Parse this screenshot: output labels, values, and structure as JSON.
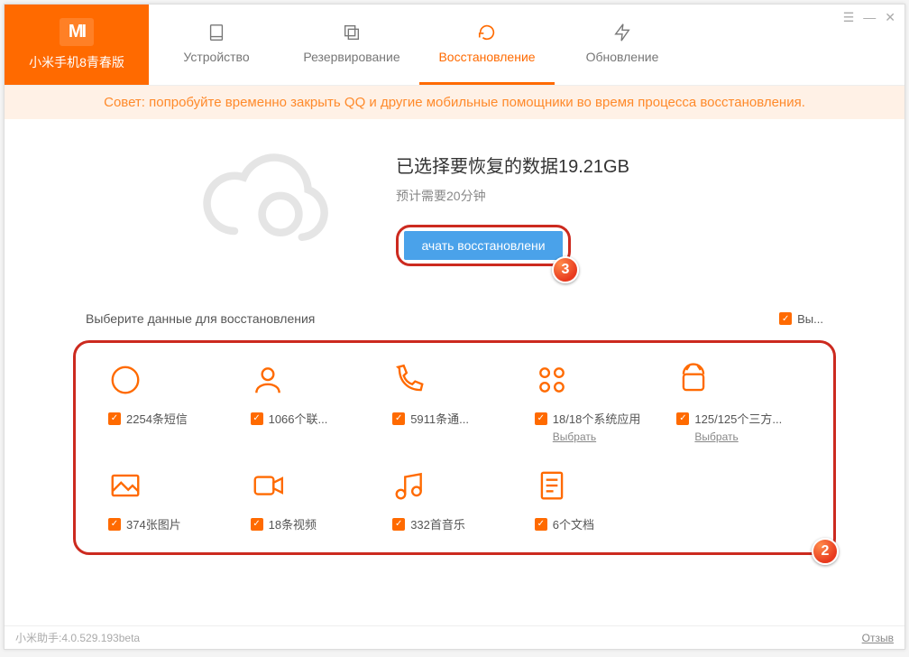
{
  "brand": {
    "logo_text": "MI",
    "subtitle": "小米手机8青春版"
  },
  "tabs": [
    {
      "label": "Устройство"
    },
    {
      "label": "Резервирование"
    },
    {
      "label": "Восстановление"
    },
    {
      "label": "Обновление"
    }
  ],
  "tip": "Совет: попробуйте временно закрыть QQ и другие мобильные помощники во время процесса восстановления.",
  "info": {
    "title": "已选择要恢复的数据19.21GB",
    "subtitle": "预计需要20分钟",
    "button": "ачать восстановлени"
  },
  "callouts": {
    "c2": "2",
    "c3": "3"
  },
  "selector": {
    "title": "Выберите данные для восстановления",
    "select_all": "Вы..."
  },
  "items": [
    {
      "label": "2254条短信",
      "sublink": ""
    },
    {
      "label": "1066个联...",
      "sublink": ""
    },
    {
      "label": "5911条通...",
      "sublink": ""
    },
    {
      "label": "18/18个系统应用",
      "sublink": "Выбрать"
    },
    {
      "label": "125/125个三方...",
      "sublink": "Выбрать"
    },
    {
      "label": "374张图片",
      "sublink": ""
    },
    {
      "label": "18条视频",
      "sublink": ""
    },
    {
      "label": "332首音乐",
      "sublink": ""
    },
    {
      "label": "6个文档",
      "sublink": ""
    }
  ],
  "footer": {
    "version": "小米助手:4.0.529.193beta",
    "feedback": "Отзыв"
  }
}
